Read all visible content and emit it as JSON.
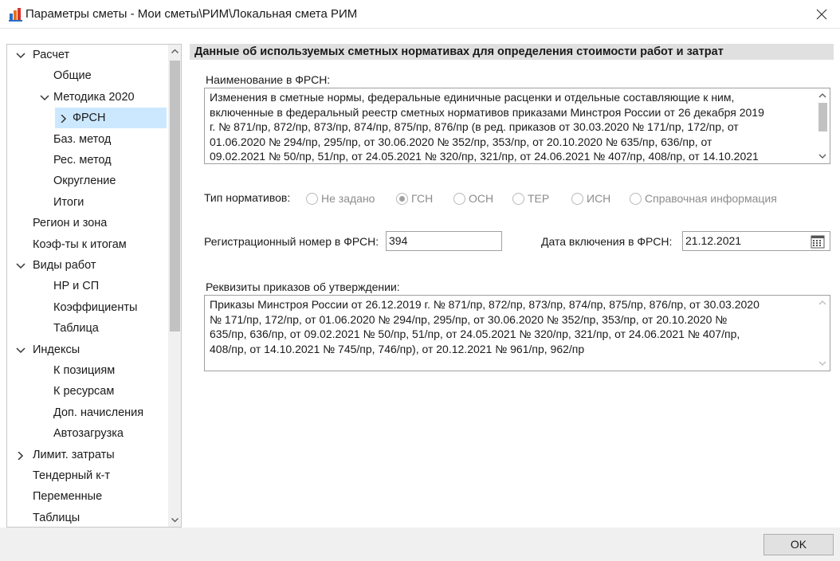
{
  "window": {
    "title": "Параметры сметы - Мои сметы\\РИМ\\Локальная смета РИМ"
  },
  "sidebar": {
    "items": [
      {
        "label": "Расчет",
        "level": 0,
        "chevron": "expanded"
      },
      {
        "label": "Общие",
        "level": 1,
        "chevron": "none"
      },
      {
        "label": "Методика 2020",
        "level": 1,
        "chevron": "expanded"
      },
      {
        "label": "ФРСН",
        "level": 2,
        "chevron": "collapsed",
        "selected": true
      },
      {
        "label": "Баз. метод",
        "level": 1,
        "chevron": "none"
      },
      {
        "label": "Рес. метод",
        "level": 1,
        "chevron": "none"
      },
      {
        "label": "Округление",
        "level": 1,
        "chevron": "none"
      },
      {
        "label": "Итоги",
        "level": 1,
        "chevron": "none"
      },
      {
        "label": "Регион и зона",
        "level": 0,
        "chevron": "none"
      },
      {
        "label": "Коэф-ты к итогам",
        "level": 0,
        "chevron": "none"
      },
      {
        "label": "Виды работ",
        "level": 0,
        "chevron": "expanded"
      },
      {
        "label": "НР и СП",
        "level": 1,
        "chevron": "none"
      },
      {
        "label": "Коэффициенты",
        "level": 1,
        "chevron": "none"
      },
      {
        "label": "Таблица",
        "level": 1,
        "chevron": "none"
      },
      {
        "label": "Индексы",
        "level": 0,
        "chevron": "expanded"
      },
      {
        "label": "К позициям",
        "level": 1,
        "chevron": "none"
      },
      {
        "label": "К ресурсам",
        "level": 1,
        "chevron": "none"
      },
      {
        "label": "Доп. начисления",
        "level": 1,
        "chevron": "none"
      },
      {
        "label": "Автозагрузка",
        "level": 1,
        "chevron": "none"
      },
      {
        "label": "Лимит. затраты",
        "level": 0,
        "chevron": "collapsed"
      },
      {
        "label": "Тендерный к-т",
        "level": 0,
        "chevron": "none"
      },
      {
        "label": "Переменные",
        "level": 0,
        "chevron": "none"
      },
      {
        "label": "Таблицы",
        "level": 0,
        "chevron": "none"
      }
    ]
  },
  "panel": {
    "header": "Данные об используемых сметных нормативах для определения стоимости работ и затрат",
    "name_label": "Наименование в ФРСН:",
    "name_lines": [
      "Изменения в сметные нормы, федеральные единичные расценки и отдельные составляющие к ним,",
      "включенные в федеральный реестр сметных нормативов приказами Минстроя России от 26 декабря 2019",
      "г. № 871/пр, 872/пр, 873/пр, 874/пр, 875/пр, 876/пр (в ред. приказов от 30.03.2020 № 171/пр, 172/пр, от",
      "01.06.2020 № 294/пр, 295/пр, от 30.06.2020 № 352/пр, 353/пр, от 20.10.2020  № 635/пр, 636/пр, от",
      "09.02.2021 № 50/пр, 51/пр, от 24.05.2021 № 320/пр, 321/пр, от 24.06.2021 № 407/пр, 408/пр, от 14.10.2021"
    ],
    "type_label": "Тип нормативов:",
    "type_options": [
      "Не задано",
      "ГСН",
      "ОСН",
      "ТЕР",
      "ИСН",
      "Справочная информация"
    ],
    "type_selected": "ГСН",
    "reg_label": "Регистрационный номер в ФРСН:",
    "reg_value": "394",
    "date_label": "Дата включения в ФРСН:",
    "date_value": "21.12.2021",
    "req_label": "Реквизиты приказов об утверждении:",
    "req_lines": [
      "Приказы Минстроя России от 26.12.2019 г. № 871/пр, 872/пр, 873/пр, 874/пр, 875/пр, 876/пр, от 30.03.2020",
      "№ 171/пр, 172/пр, от 01.06.2020 № 294/пр, 295/пр, от 30.06.2020 № 352/пр, 353/пр, от 20.10.2020  №",
      "635/пр, 636/пр, от 09.02.2021 № 50/пр, 51/пр, от 24.05.2021 № 320/пр, 321/пр, от 24.06.2021 № 407/пр,",
      "408/пр, от 14.10.2021 № 745/пр, 746/пр), от 20.12.2021 № 961/пр, 962/пр"
    ]
  },
  "footer": {
    "ok_label": "OK"
  },
  "colors": {
    "selection": "#cce8ff",
    "header_bg": "#e0e0e0",
    "footer_bg": "#f0f0f0"
  }
}
